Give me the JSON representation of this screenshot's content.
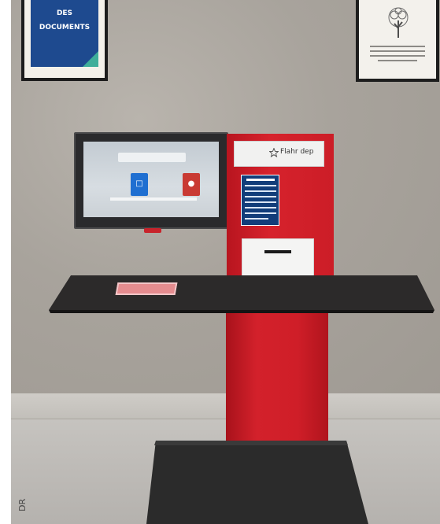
{
  "photo": {
    "poster_left": {
      "line1": "DES",
      "line2": "DOCUMENTS"
    },
    "kiosk": {
      "brand": "Flahr dep"
    },
    "credit": "DR"
  },
  "colors": {
    "wall": "#a8a39c",
    "kiosk_red": "#d6222c",
    "table_top": "#2c2a2a",
    "poster_blue": "#1e4a8f",
    "poster_teal": "#3fae9a",
    "screen_tile_blue": "#1f6fd1",
    "screen_tile_red": "#c93a33"
  }
}
